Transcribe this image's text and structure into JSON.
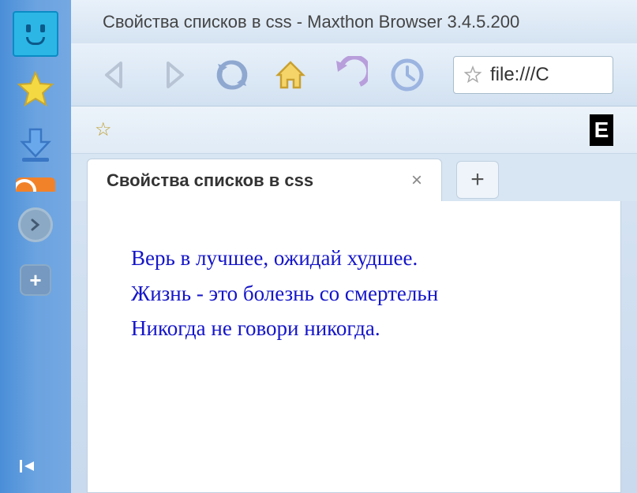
{
  "window": {
    "title": "Свойства списков в css - Maxthon Browser 3.4.5.200"
  },
  "toolbar": {
    "back": "back",
    "forward": "forward",
    "refresh": "refresh",
    "home": "home",
    "undo": "undo",
    "history": "history"
  },
  "addressbar": {
    "url": "file:///C"
  },
  "bookmarks": {
    "star": "☆",
    "badge": "E"
  },
  "tab": {
    "title": "Свойства списков в css",
    "close": "×",
    "new": "+"
  },
  "page": {
    "line1": "Верь в лучшее, ожидай худшее.",
    "line2": "Жизнь - это болезнь со смертельн",
    "line3": "Никогда не говори никогда."
  },
  "sidebar": {
    "plus": "+"
  }
}
